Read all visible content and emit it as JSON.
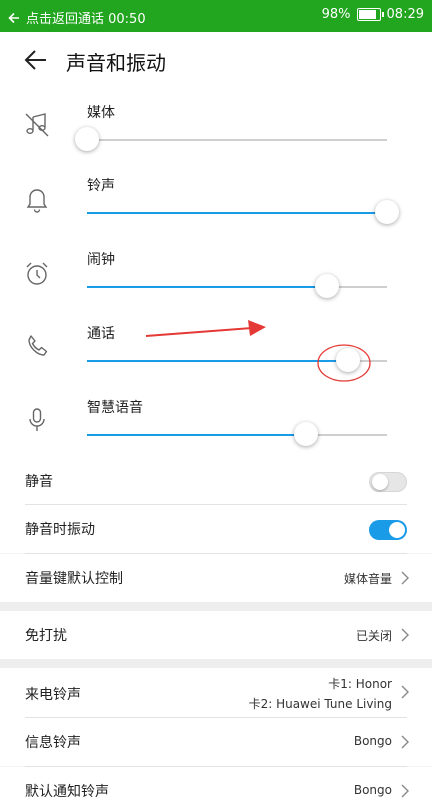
{
  "status_bar": {
    "back_text": "点击返回通话 00:50",
    "battery": "98%",
    "battery_level": 0.98,
    "time": "08:29"
  },
  "header": {
    "title": "声音和振动"
  },
  "volumes": [
    {
      "label": "媒体",
      "icon": "music-off-icon",
      "level": 0.0
    },
    {
      "label": "铃声",
      "icon": "bell-icon",
      "level": 1.0
    },
    {
      "label": "闹钟",
      "icon": "alarm-clock-icon",
      "level": 0.8
    },
    {
      "label": "通话",
      "icon": "phone-icon",
      "level": 0.87
    },
    {
      "label": "智慧语音",
      "icon": "microphone-icon",
      "level": 0.73
    }
  ],
  "settings": {
    "mute": {
      "label": "静音",
      "on": false
    },
    "vibrate_on_mute": {
      "label": "静音时振动",
      "on": true
    },
    "volume_key": {
      "label": "音量键默认控制",
      "value": "媒体音量"
    },
    "dnd": {
      "label": "免打扰",
      "value": "已关闭"
    },
    "ringtone": {
      "label": "来电铃声",
      "value_line1": "卡1: Honor",
      "value_line2": "卡2: Huawei Tune Living"
    },
    "message_tone": {
      "label": "信息铃声",
      "value": "Bongo"
    },
    "notification_tone": {
      "label": "默认通知铃声",
      "value": "Bongo"
    }
  },
  "colors": {
    "status_bar": "#22a51f",
    "accent": "#1a9be8",
    "annotation": "#e53935"
  }
}
